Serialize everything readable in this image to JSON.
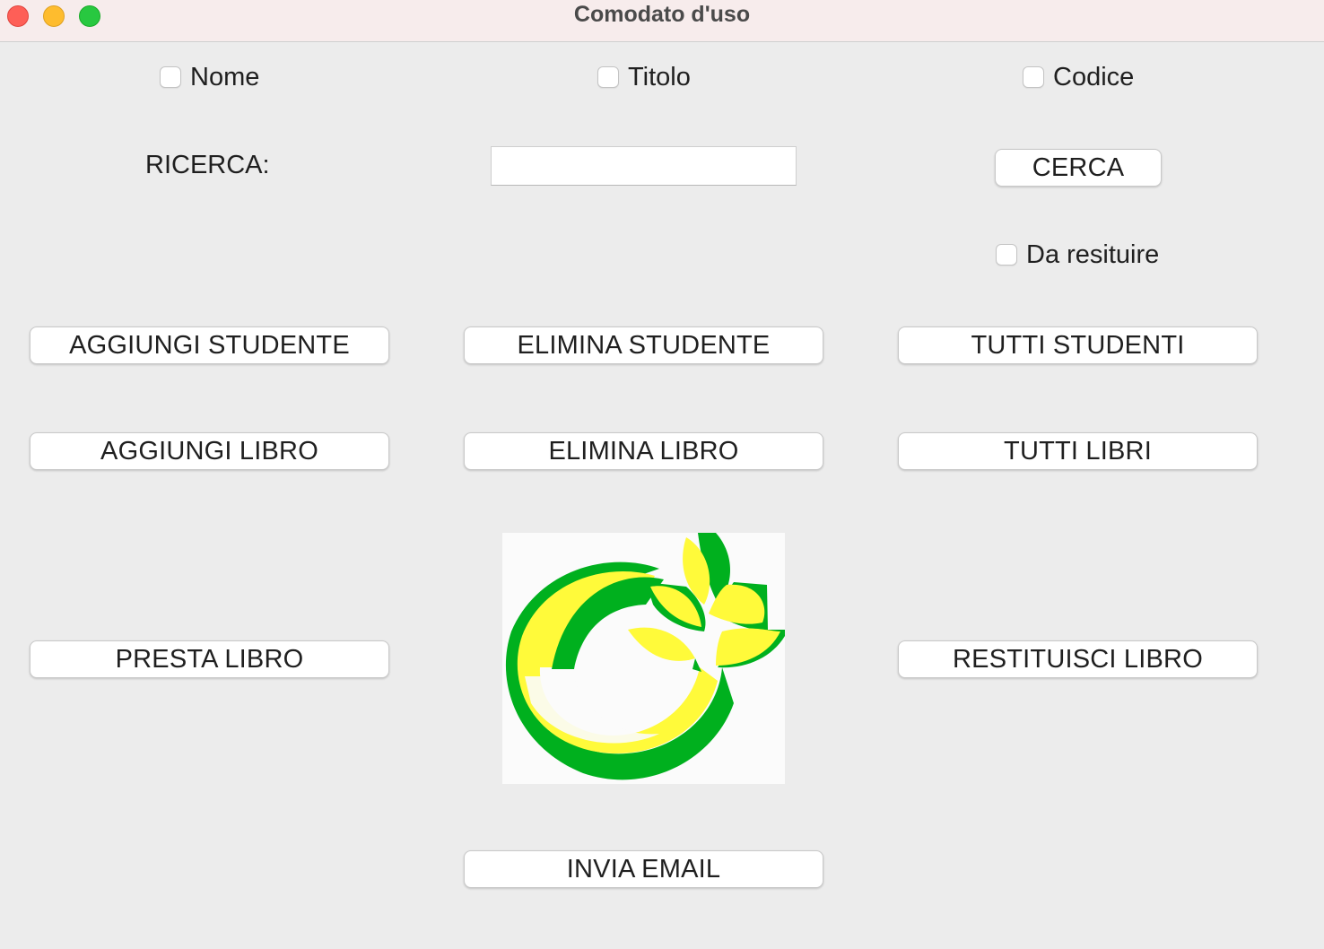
{
  "window": {
    "title": "Comodato d'uso"
  },
  "filters": {
    "nome": "Nome",
    "titolo": "Titolo",
    "codice": "Codice",
    "da_restituire": "Da resituire"
  },
  "search": {
    "label": "RICERCA:",
    "value": "",
    "button": "CERCA"
  },
  "buttons": {
    "aggiungi_studente": "AGGIUNGI STUDENTE",
    "elimina_studente": "ELIMINA STUDENTE",
    "tutti_studenti": "TUTTI STUDENTI",
    "aggiungi_libro": "AGGIUNGI LIBRO",
    "elimina_libro": "ELIMINA LIBRO",
    "tutti_libri": "TUTTI LIBRI",
    "presta_libro": "PRESTA LIBRO",
    "restituisci_libro": "RESTITUISCI LIBRO",
    "invia_email": "INVIA EMAIL"
  },
  "colors": {
    "logo_green": "#00b01e",
    "logo_yellow": "#fffa3a"
  },
  "logo": {
    "icon": "leaf-circle-logo"
  }
}
